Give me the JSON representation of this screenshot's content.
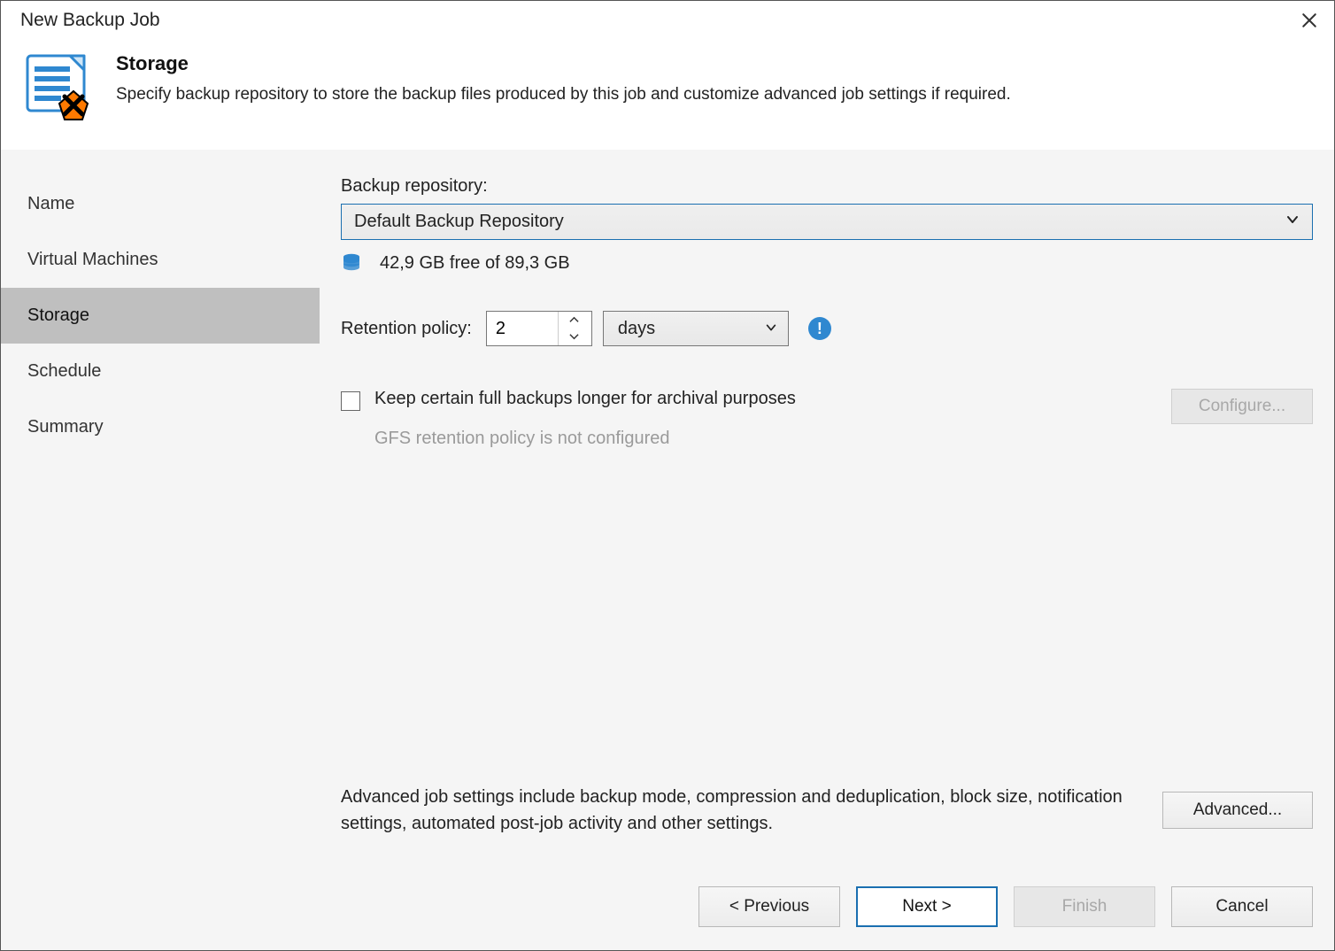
{
  "window": {
    "title": "New Backup Job"
  },
  "header": {
    "title": "Storage",
    "description": "Specify backup repository to store the backup files produced by this job and customize advanced job settings if required."
  },
  "sidebar": {
    "items": [
      {
        "label": "Name",
        "active": false
      },
      {
        "label": "Virtual Machines",
        "active": false
      },
      {
        "label": "Storage",
        "active": true
      },
      {
        "label": "Schedule",
        "active": false
      },
      {
        "label": "Summary",
        "active": false
      }
    ]
  },
  "content": {
    "repo_label": "Backup repository:",
    "repo_selected": "Default Backup Repository",
    "repo_free_text": "42,9 GB free of 89,3 GB",
    "retention_label": "Retention policy:",
    "retention_value": "2",
    "retention_unit": "days",
    "gfs_checkbox_label": "Keep certain full backups longer for archival purposes",
    "gfs_status": "GFS retention policy is not configured",
    "configure_button": "Configure...",
    "advanced_desc": "Advanced job settings include backup mode, compression and deduplication, block size, notification settings, automated post-job activity and other settings.",
    "advanced_button": "Advanced..."
  },
  "footer": {
    "previous": "< Previous",
    "next": "Next >",
    "finish": "Finish",
    "cancel": "Cancel"
  }
}
